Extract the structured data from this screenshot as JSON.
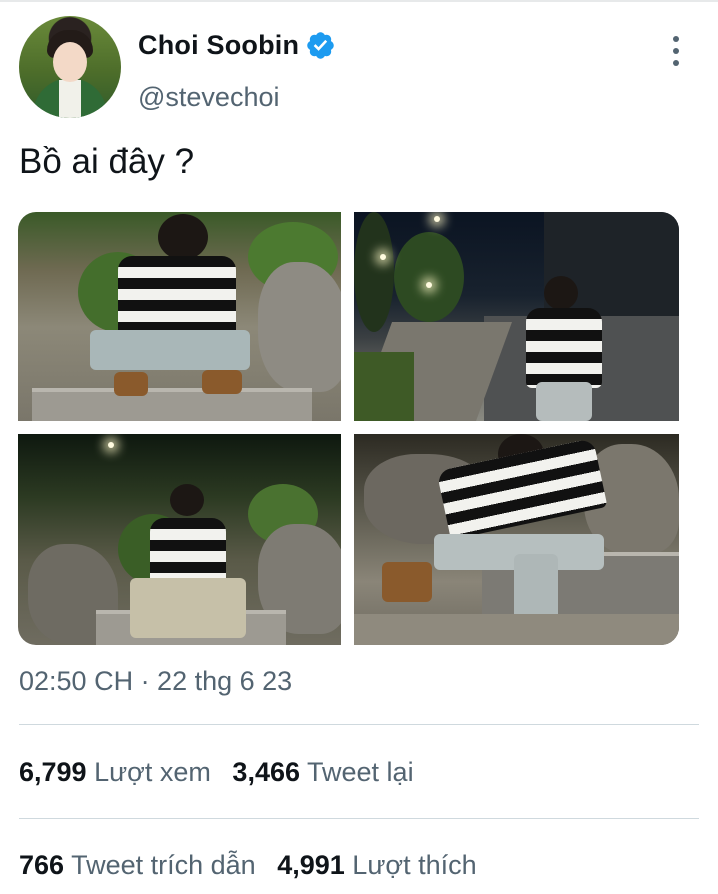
{
  "author": {
    "display_name": "Choi Soobin",
    "handle": "@stevechoi",
    "verified_icon": "verified-badge-icon"
  },
  "tweet": {
    "text": "Bồ ai đây ?",
    "timestamp": "02:50 CH · 22 thg 6 23",
    "media_count": 4
  },
  "stats_row1": [
    {
      "value": "6,799",
      "label": "Lượt xem"
    },
    {
      "value": "3,466",
      "label": "Tweet lại"
    }
  ],
  "stats_row2": [
    {
      "value": "766",
      "label": "Tweet trích dẫn"
    },
    {
      "value": "4,991",
      "label": "Lượt thích"
    }
  ],
  "colors": {
    "text": "#0f1419",
    "secondary": "#536471",
    "verified": "#1d9bf0",
    "divider": "#cfd9de"
  },
  "icons": [
    "verified-badge-icon",
    "more-options-icon"
  ]
}
